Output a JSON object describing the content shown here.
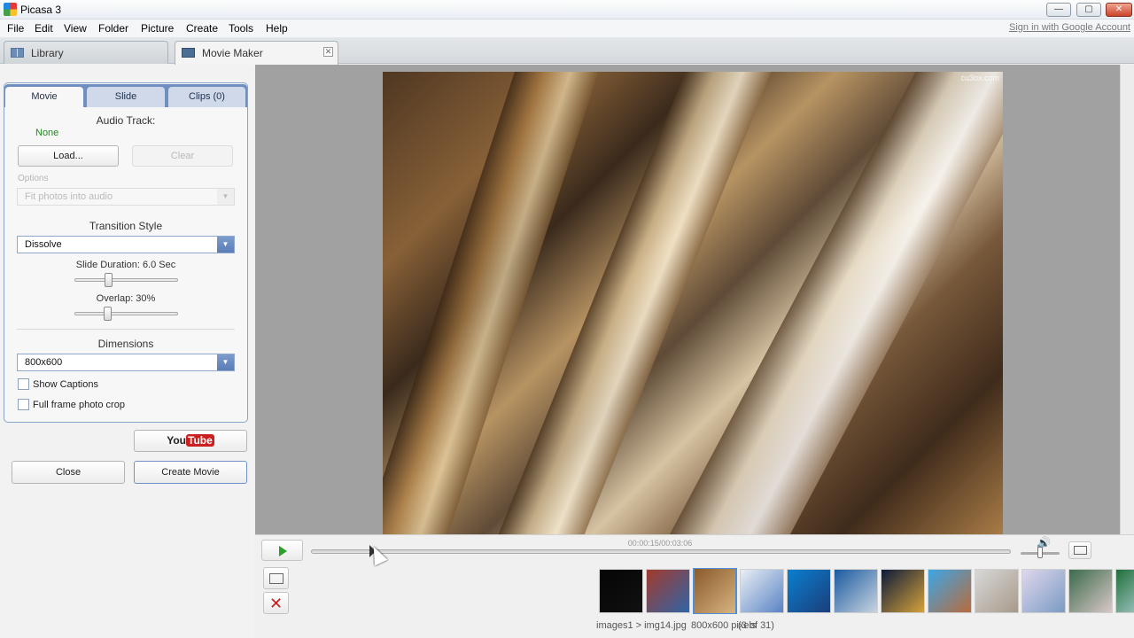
{
  "window": {
    "title": "Picasa 3",
    "min_glyph": "—",
    "max_glyph": "▢",
    "close_glyph": "✕"
  },
  "menu": {
    "items": [
      "File",
      "Edit",
      "View",
      "Folder",
      "Picture",
      "Create",
      "Tools",
      "Help"
    ],
    "sign_in": "Sign in with Google Account"
  },
  "tabs": {
    "library": "Library",
    "movie_maker": "Movie Maker",
    "close_glyph": "✕"
  },
  "panel": {
    "tabs": [
      "Movie",
      "Slide",
      "Clips (0)"
    ],
    "audio": {
      "title": "Audio Track:",
      "value": "None",
      "load": "Load...",
      "clear": "Clear"
    },
    "options": {
      "label": "Options",
      "value": "Fit photos into audio"
    },
    "transition": {
      "title": "Transition Style",
      "value": "Dissolve"
    },
    "slide_duration": {
      "label": "Slide Duration: 6.0 Sec",
      "fraction": 0.31
    },
    "overlap": {
      "label": "Overlap: 30%",
      "fraction": 0.3
    },
    "dimensions": {
      "title": "Dimensions",
      "value": "800x600"
    },
    "show_captions": {
      "label": "Show Captions",
      "checked": false
    },
    "full_frame": {
      "label": "Full frame photo crop",
      "checked": false
    },
    "youtube": {
      "you": "You",
      "tube": "Tube"
    },
    "close": "Close",
    "create": "Create Movie"
  },
  "preview": {
    "watermark": "cu3ox.com"
  },
  "playback": {
    "timecode": "00:00:15/00:03:06",
    "progress_fraction": 0.08,
    "volume_fraction": 0.5,
    "arrow_glyph": "▼",
    "speaker_glyph": "🔊",
    "remove_glyph": "✕"
  },
  "filmstrip": {
    "thumbs": [
      {
        "colors": [
          "#050505",
          "#111111"
        ]
      },
      {
        "colors": [
          "#a23a2c",
          "#2f65a7"
        ]
      },
      {
        "colors": [
          "#8b5a2b",
          "#d6b480"
        ],
        "selected": true
      },
      {
        "colors": [
          "#e9eef4",
          "#5a83c4"
        ]
      },
      {
        "colors": [
          "#0a7fd0",
          "#1b3e7a"
        ]
      },
      {
        "colors": [
          "#1a5aa0",
          "#c9d4e0"
        ]
      },
      {
        "colors": [
          "#0c1a3a",
          "#d5a23a"
        ]
      },
      {
        "colors": [
          "#3ca6e6",
          "#b86b3c"
        ]
      },
      {
        "colors": [
          "#d8d8d8",
          "#a89a8a"
        ]
      },
      {
        "colors": [
          "#e0d7ec",
          "#7a9bc4"
        ]
      },
      {
        "colors": [
          "#3b6b4c",
          "#d9c7c7"
        ]
      },
      {
        "colors": [
          "#1f6f3a",
          "#c4dbe8"
        ]
      }
    ]
  },
  "status": {
    "path": "images1 > img14.jpg",
    "size": "800x600 pixels",
    "count": "(3 of 31)"
  }
}
